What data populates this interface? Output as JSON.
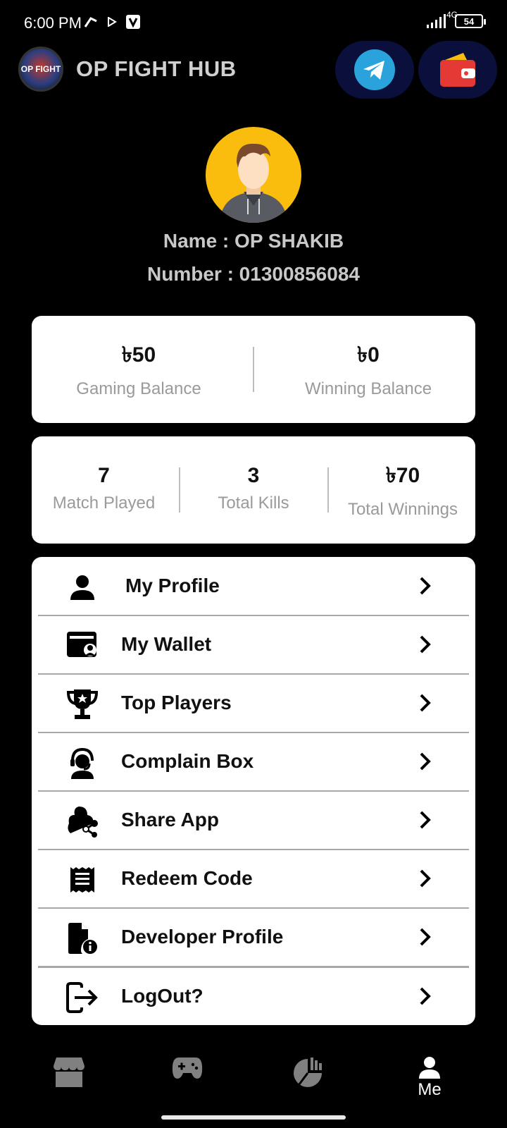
{
  "status_bar": {
    "time": "6:00 PM",
    "network": "4G",
    "battery": "54"
  },
  "app_bar": {
    "logo_text": "OP FIGHT",
    "title": "OP FIGHT HUB"
  },
  "profile": {
    "name": "Name : OP SHAKIB",
    "number": "Number : 01300856084"
  },
  "balances": [
    {
      "value": "৳50",
      "label": "Gaming Balance"
    },
    {
      "value": "৳0",
      "label": "Winning Balance"
    }
  ],
  "stats": [
    {
      "value": "7",
      "label": "Match Played"
    },
    {
      "value": "3",
      "label": "Total Kills"
    },
    {
      "value": "৳70",
      "label": "Total Winnings"
    }
  ],
  "menu": [
    {
      "label": "My Profile",
      "icon": "person-icon"
    },
    {
      "label": "My Wallet",
      "icon": "wallet-user-icon"
    },
    {
      "label": "Top Players",
      "icon": "trophy-icon"
    },
    {
      "label": "Complain Box",
      "icon": "support-agent-icon"
    },
    {
      "label": "Share App",
      "icon": "share-icon"
    },
    {
      "label": "Redeem Code",
      "icon": "receipt-icon"
    },
    {
      "label": "Developer Profile",
      "icon": "file-info-icon"
    },
    {
      "label": "LogOut?",
      "icon": "logout-icon"
    }
  ],
  "bottom_nav": {
    "active": "Me",
    "items": [
      {
        "icon": "store-icon"
      },
      {
        "icon": "gamepad-icon"
      },
      {
        "icon": "chart-pie-icon"
      },
      {
        "icon": "person-icon",
        "label": "Me"
      }
    ]
  },
  "colors": {
    "background": "#000000",
    "card": "#ffffff",
    "avatar_bg": "#fbbd0d",
    "top_button_bg": "#0a0f3c",
    "telegram": "#2aa3dd",
    "wallet": "#e53935"
  }
}
